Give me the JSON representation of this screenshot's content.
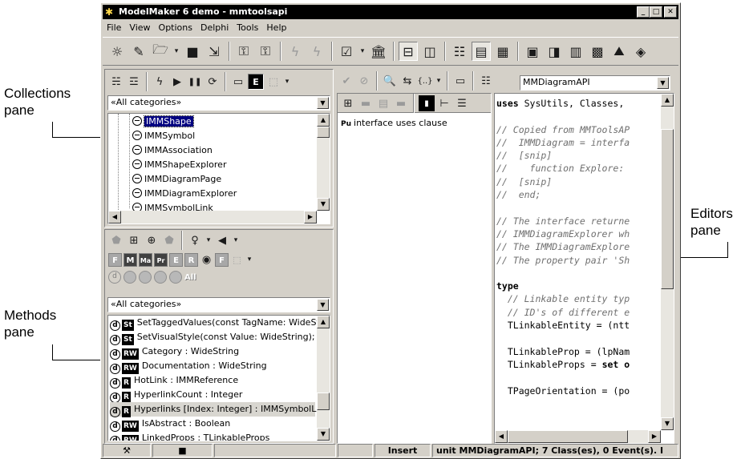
{
  "callouts": {
    "collections": "Collections\npane",
    "methods": "Methods\npane",
    "editors": "Editors\npane"
  },
  "window": {
    "title": "ModelMaker 6 demo - mmtoolsapi",
    "min": "_",
    "max": "□",
    "close": "✕"
  },
  "menu": [
    "File",
    "View",
    "Options",
    "Delphi",
    "Tools",
    "Help"
  ],
  "collections": {
    "filter": "«All categories»",
    "items": [
      "IMMShape",
      "IMMSymbol",
      "IMMAssociation",
      "IMMShapeExplorer",
      "IMMDiagramPage",
      "IMMDiagramExplorer",
      "IMMSymbolLink"
    ],
    "selected_index": 0
  },
  "methods": {
    "all_label": "All",
    "filter": "«All categories»",
    "rows": [
      {
        "kind": "St",
        "text": "SetTaggedValues(const TagName: WideStri"
      },
      {
        "kind": "St",
        "text": "SetVisualStyle(const Value: WideString);"
      },
      {
        "kind": "RW",
        "text": "Category : WideString"
      },
      {
        "kind": "RW",
        "text": "Documentation : WideString"
      },
      {
        "kind": "R",
        "text": "HotLink : IMMReference"
      },
      {
        "kind": "R",
        "text": "HyperlinkCount : Integer"
      },
      {
        "kind": "R",
        "text": "Hyperlinks [Index: Integer] : IMMSymbolLink"
      },
      {
        "kind": "RW",
        "text": "IsAbstract : Boolean"
      },
      {
        "kind": "RW",
        "text": "LinkedProps : TLinkableProps"
      }
    ],
    "selected_index": 6
  },
  "middle": {
    "item_icon": "Pu",
    "item": "interface uses clause"
  },
  "editor": {
    "unit_combo": "MMDiagramAPI",
    "code_lines": [
      {
        "t": "code",
        "s": "uses SysUtils, Classes,"
      },
      {
        "t": "blank",
        "s": ""
      },
      {
        "t": "cm",
        "s": "// Copied from MMToolsAP"
      },
      {
        "t": "cm",
        "s": "//  IMMDiagram = interfa"
      },
      {
        "t": "cm",
        "s": "//  [snip]"
      },
      {
        "t": "cm",
        "s": "//    function Explore:"
      },
      {
        "t": "cm",
        "s": "//  [snip]"
      },
      {
        "t": "cm",
        "s": "//  end;"
      },
      {
        "t": "blank",
        "s": ""
      },
      {
        "t": "cm",
        "s": "// The interface returne"
      },
      {
        "t": "cm",
        "s": "// IMMDiagramExplorer wh"
      },
      {
        "t": "cm",
        "s": "// The IMMDiagramExplore"
      },
      {
        "t": "cm",
        "s": "// The property pair 'Sh"
      },
      {
        "t": "blank",
        "s": ""
      },
      {
        "t": "kw",
        "s": "type"
      },
      {
        "t": "cm",
        "s": "  // Linkable entity typ"
      },
      {
        "t": "cm",
        "s": "  // ID's of different e"
      },
      {
        "t": "code",
        "s": "  TLinkableEntity = (ntt"
      },
      {
        "t": "blank",
        "s": ""
      },
      {
        "t": "code",
        "s": "  TLinkableProp = (lpNam"
      },
      {
        "t": "mix",
        "s": "  TLinkableProps = set o"
      },
      {
        "t": "blank",
        "s": ""
      },
      {
        "t": "code",
        "s": "  TPageOrientation = (po"
      }
    ]
  },
  "status": {
    "insert": "Insert",
    "info": "unit MMDiagramAPI; 7 Class(es), 0 Event(s). I"
  }
}
